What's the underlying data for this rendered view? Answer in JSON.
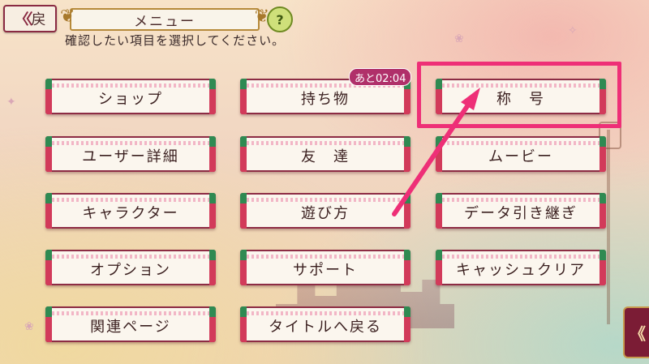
{
  "header": {
    "back_label": "戻",
    "title": "メニュー",
    "help_label": "?"
  },
  "instruction": "確認したい項目を選択してください。",
  "menu": {
    "col1": [
      "ショップ",
      "ユーザー詳細",
      "キャラクター",
      "オプション",
      "関連ページ"
    ],
    "col2": [
      "持ち物",
      "友　達",
      "遊び方",
      "サポート",
      "タイトルへ戻る"
    ],
    "col3": [
      "称　号",
      "ムービー",
      "データ引き継ぎ",
      "キャッシュクリア"
    ]
  },
  "timer_badge": "あと02:04",
  "side_tab_label": "《",
  "colors": {
    "accent": "#ee2f77",
    "frame": "#8d2c44"
  }
}
